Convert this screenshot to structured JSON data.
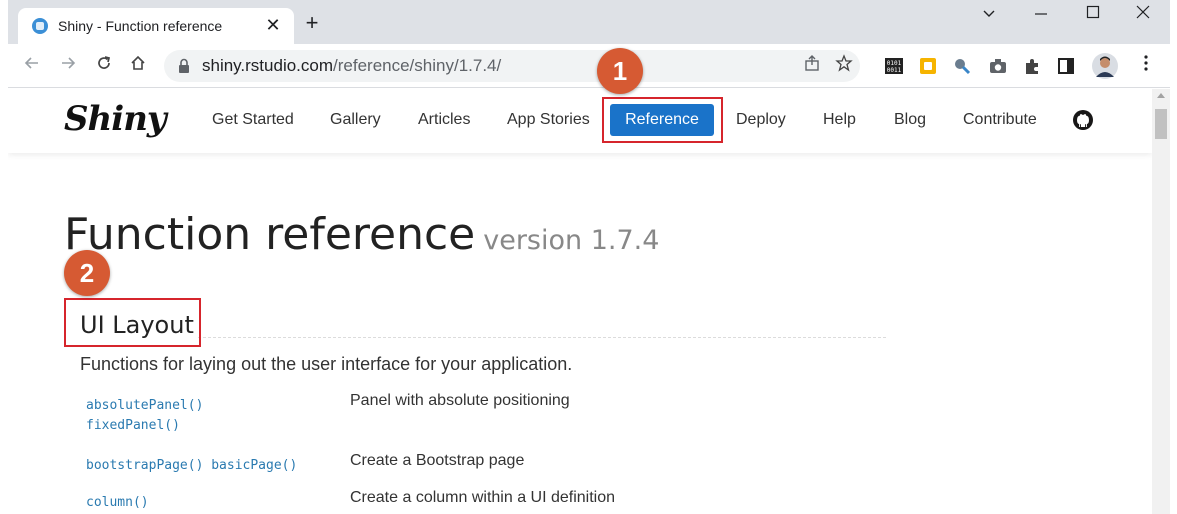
{
  "browser": {
    "tab_title": "Shiny - Function reference",
    "tab_close": "✕",
    "new_tab": "+",
    "url_host": "shiny.rstudio.com",
    "url_path": "/reference/shiny/1.7.4/",
    "window_controls": [
      "minimize",
      "maximize",
      "close"
    ]
  },
  "site": {
    "logo": "Shiny",
    "nav": [
      "Get Started",
      "Gallery",
      "Articles",
      "App Stories",
      "Reference",
      "Deploy",
      "Help",
      "Blog",
      "Contribute"
    ],
    "active_nav": "Reference",
    "active_color": "#1a73c9"
  },
  "annotations": {
    "badge1": "1",
    "badge2": "2",
    "color": "#d65a33",
    "box_color": "#d6252c"
  },
  "page": {
    "title": "Function reference",
    "version": "version 1.7.4",
    "section_title": "UI Layout",
    "section_desc": "Functions for laying out the user interface for your application.",
    "rows": [
      {
        "fns": [
          "absolutePanel()",
          "fixedPanel()"
        ],
        "desc": "Panel with absolute positioning"
      },
      {
        "fns": [
          "bootstrapPage() basicPage()"
        ],
        "desc": "Create a Bootstrap page"
      },
      {
        "fns": [
          "column()"
        ],
        "desc": "Create a column within a UI definition"
      }
    ]
  }
}
